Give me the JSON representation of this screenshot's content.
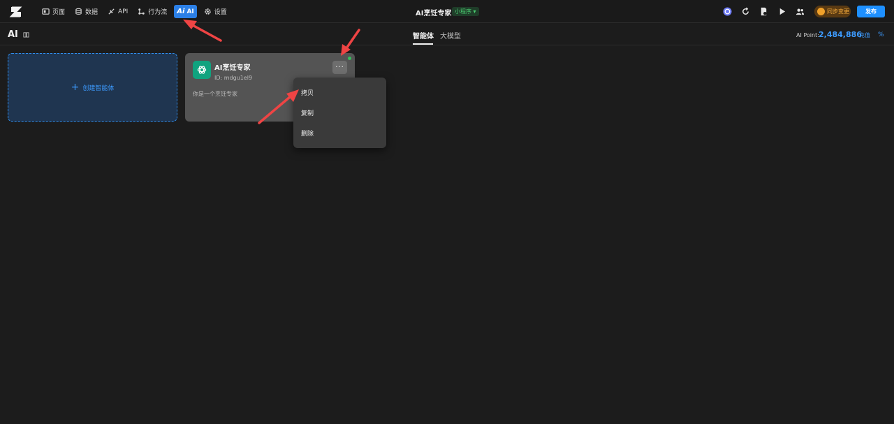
{
  "nav": {
    "items": [
      {
        "label": "页面",
        "icon": "page-icon"
      },
      {
        "label": "数据",
        "icon": "database-icon"
      },
      {
        "label": "API",
        "icon": "api-icon"
      },
      {
        "label": "行为流",
        "icon": "flow-icon"
      },
      {
        "label": "AI",
        "icon": "ai-icon",
        "glyph": "Ai",
        "active": true
      },
      {
        "label": "设置",
        "icon": "gear-icon"
      }
    ]
  },
  "header": {
    "app_name": "AI烹饪专家",
    "app_type": "小程序",
    "sync_label": "同步变更",
    "publish_label": "发布"
  },
  "subheader": {
    "title": "AI",
    "tabs": [
      {
        "label": "智能体",
        "active": true
      },
      {
        "label": "大模型",
        "active": false
      }
    ],
    "ai_point_label": "AI Point:",
    "ai_point_value": "2,484,886",
    "recharge_label": "充值",
    "percent_glyph": "%"
  },
  "create_card": {
    "plus": "+",
    "label": "创建智能体"
  },
  "agent": {
    "name": "AI烹饪专家",
    "id_text": "ID: mdgu1el9",
    "description": "你是一个烹饪专家",
    "more_glyph": "···"
  },
  "menu": {
    "items": [
      "拷贝",
      "复制",
      "删除"
    ]
  },
  "colors": {
    "accent": "#1e90ff",
    "annotation_arrow": "#ef4444",
    "status_online": "#33c25a"
  }
}
